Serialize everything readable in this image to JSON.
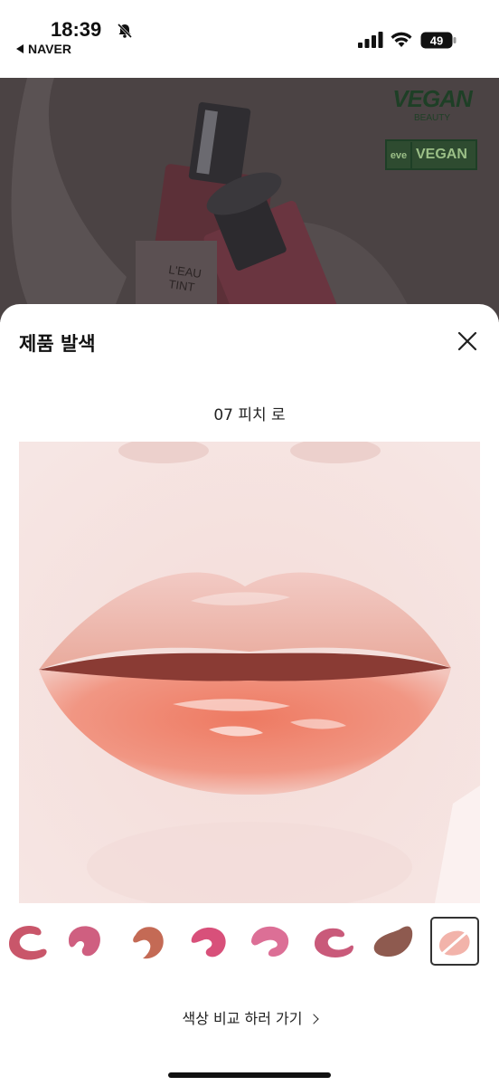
{
  "status_bar": {
    "time": "18:39",
    "back_app": "NAVER",
    "battery": "49"
  },
  "banner": {
    "product_label_line1": "L'EAU",
    "product_label_line2": "TINT",
    "vegan_logo_big": "VEGAN",
    "vegan_logo_small": "BEAUTY",
    "vegan_box_eve": "eve",
    "vegan_box_text": "VEGAN"
  },
  "sheet": {
    "title": "제품 발색",
    "close_icon": "close-icon",
    "shade_name": "07 피치 로",
    "compare_link": "색상 비교 하러 가기",
    "swatches": [
      {
        "color": "#c9566a"
      },
      {
        "color": "#cf5f80"
      },
      {
        "color": "#c46a55"
      },
      {
        "color": "#d8507a"
      },
      {
        "color": "#dc6f96"
      },
      {
        "color": "#c95a7a"
      },
      {
        "color": "#8e5a4f"
      },
      {
        "color": "#f2b3aa",
        "selected": true
      }
    ],
    "selected_index": 7
  },
  "colors": {
    "scrim": "#4b4344",
    "lip": "#f08a77"
  }
}
